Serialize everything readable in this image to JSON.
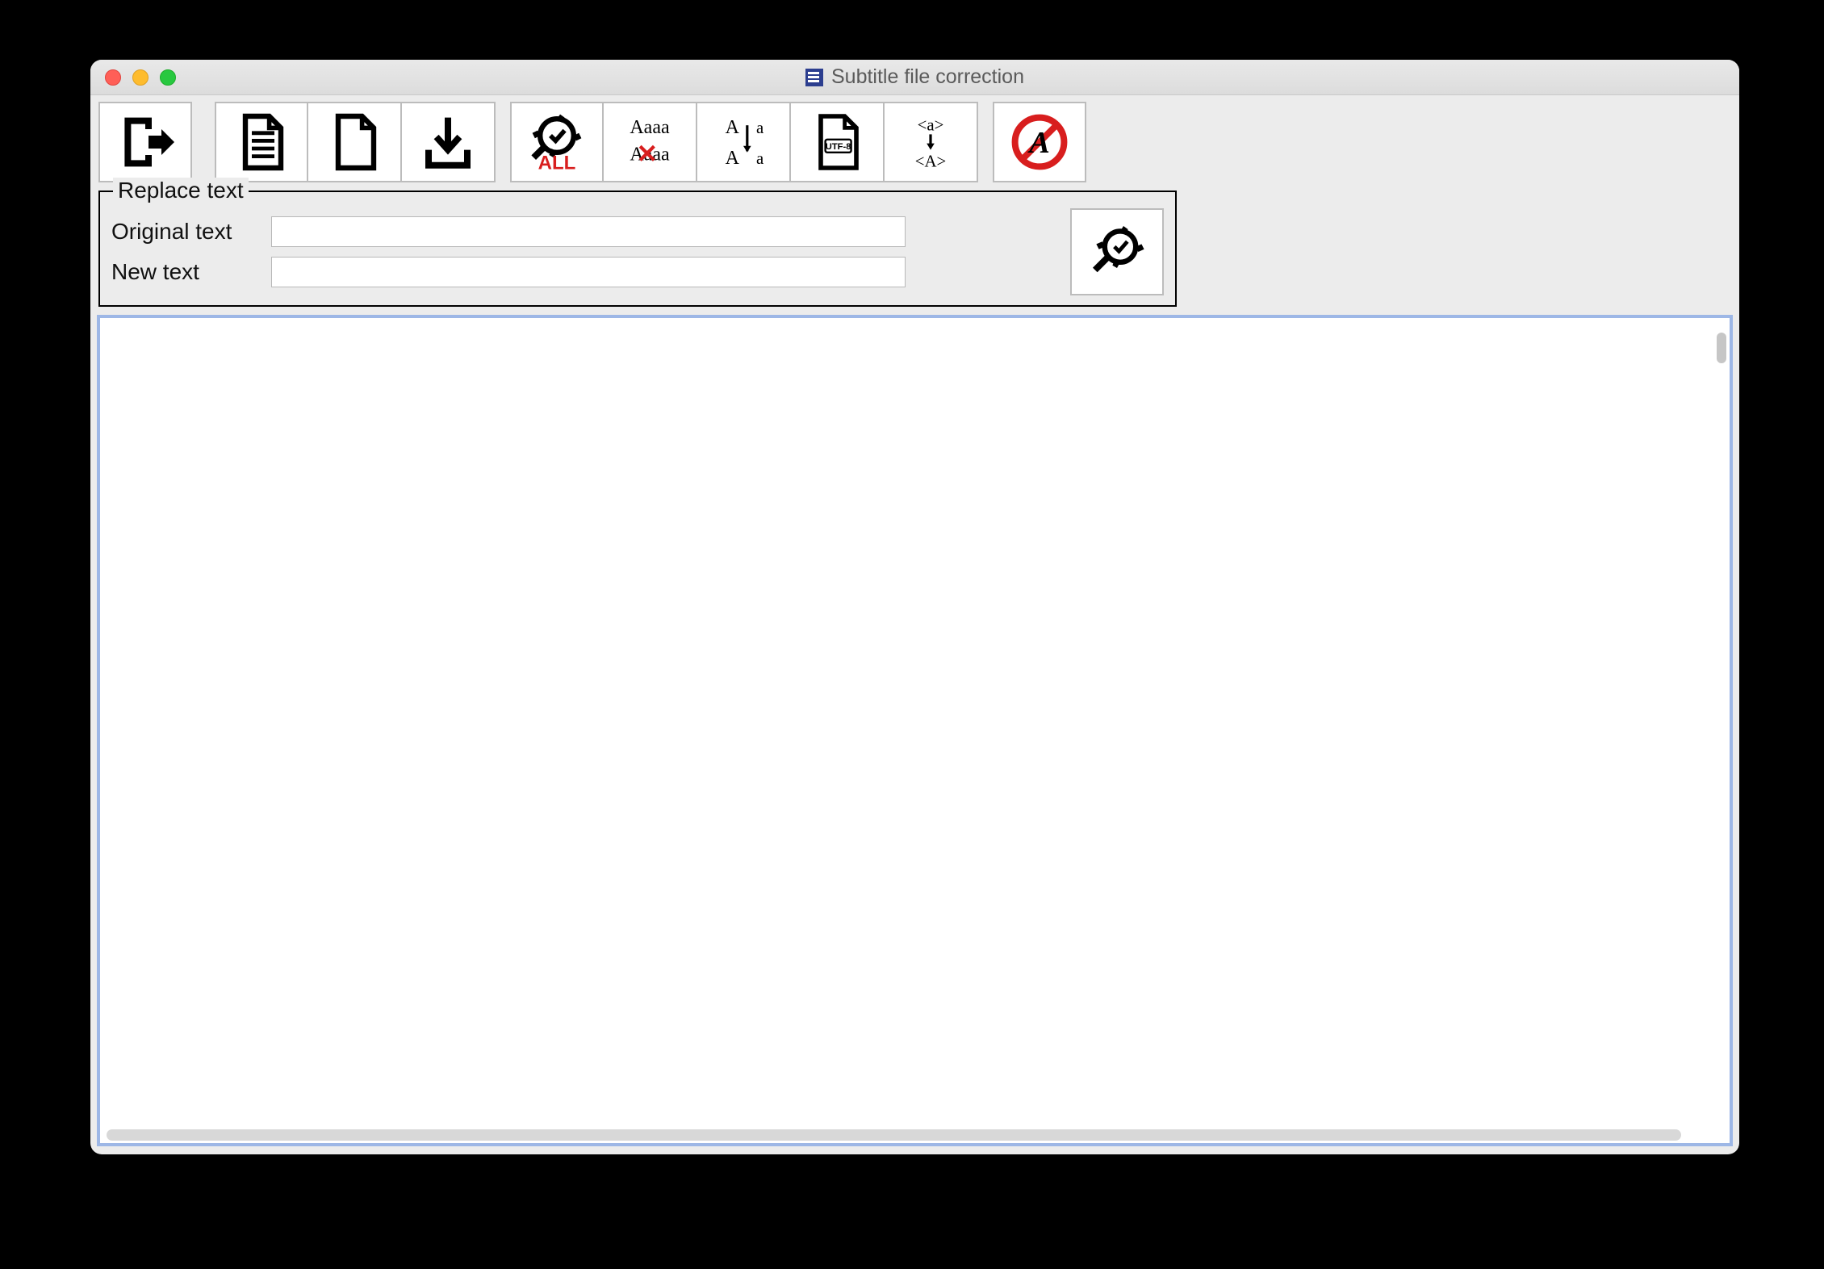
{
  "window": {
    "title": "Subtitle file correction"
  },
  "toolbar": {
    "icons": {
      "exit": "exit-icon",
      "open": "open-file-icon",
      "new": "blank-file-icon",
      "save": "download-icon",
      "fixall": "fix-all-icon",
      "removedup": "remove-duplicate-icon",
      "case": "case-convert-icon",
      "utf8": "utf8-convert-icon",
      "tagcase": "tag-case-icon",
      "nostyle": "no-style-icon"
    }
  },
  "replace": {
    "legend": "Replace text",
    "original_label": "Original text",
    "new_label": "New text",
    "original_value": "",
    "new_value": ""
  },
  "editor": {
    "content": ""
  }
}
